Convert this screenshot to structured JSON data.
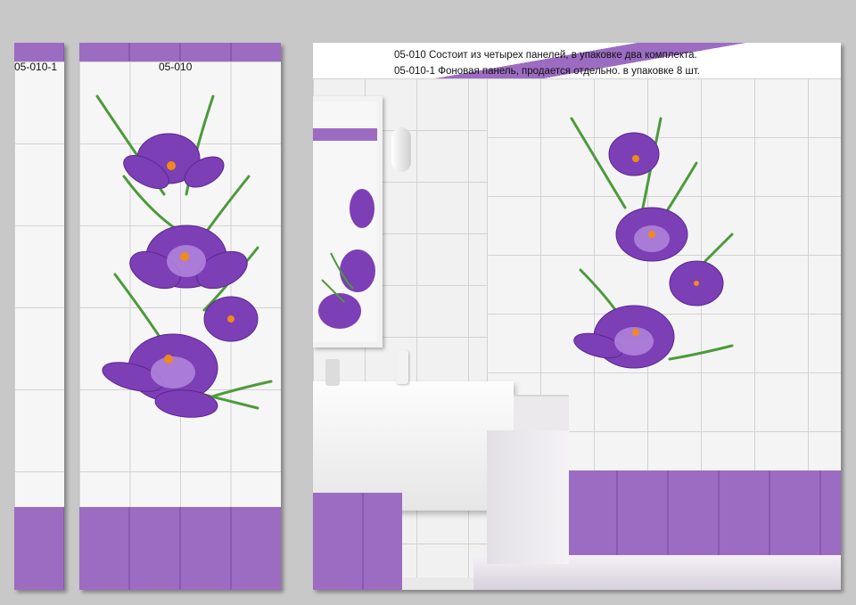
{
  "panels": [
    {
      "code": "05-010-1"
    },
    {
      "code": "05-010"
    }
  ],
  "description": {
    "line1": "05-010 Состоит из четырех панелей, в упаковке два комплекта.",
    "line2": "05-010-1 Фоновая панель, продается отдельно. в упаковке 8 шт."
  },
  "colors": {
    "accent_purple": "#9c6cc2",
    "tile_white": "#f6f6f6",
    "background": "#c8c8c8",
    "flower": "#7d3fb5",
    "leaf": "#4c9a3b",
    "stamen": "#f08a1a"
  },
  "icons": [
    "crocus-flower-icon"
  ]
}
